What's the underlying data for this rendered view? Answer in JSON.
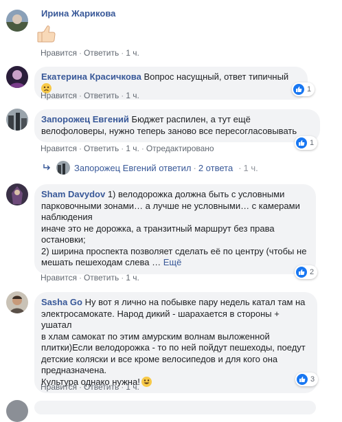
{
  "actions": {
    "like": "Нравится",
    "reply": "Ответить",
    "edited": "Отредактировано",
    "more": "Ещё"
  },
  "comments": [
    {
      "author": "Ирина Жарикова",
      "text": "",
      "sticker": "thumbs-up",
      "time": "1 ч."
    },
    {
      "author": "Екатерина Красичкова",
      "text": "Вопрос насущный, ответ типичный",
      "emoji": "sad-face",
      "time": "1 ч.",
      "reactions": "1"
    },
    {
      "author": "Запорожец Евгений",
      "text_lines": [
        "Бюджет распилен, а тут ещё",
        "велофоловеры, нужно теперь заново все пересогласовывать"
      ],
      "time": "1 ч.",
      "reactions": "1",
      "reply_summary": {
        "text": "Запорожец Евгений ответил",
        "count": "2 ответа",
        "time": "1 ч."
      }
    },
    {
      "author": "Sham Davydov",
      "text_lines": [
        "1) велодорожка должна быть с условными",
        "парковочными зонами… а лучше не условными… с камерами",
        "наблюдения",
        "иначе это не дорожка, а транзитный маршрут без права",
        "остановки;",
        "2) ширина проспекта позволяет сделать её по центру (чтобы не",
        "мешать пешеходам слева …"
      ],
      "time": "1 ч.",
      "reactions": "2"
    },
    {
      "author": "Sasha Go",
      "text_lines": [
        "Ну вот я лично на побывке пару недель катал там на",
        "электросамокате. Народ дикий - шарахается в стороны + ушатал",
        "в хлам самокат по этим амурским волнам выложенной",
        "плитки)Если велодорожка - то по ней пойдут пешеходы, поедут",
        "детские коляски и все кроме велосипедов и для кого она",
        "предназначена.",
        "Культура однако нужна!"
      ],
      "emoji": "smile",
      "time": "1 ч.",
      "reactions": "3"
    }
  ],
  "colors": {
    "link": "#385898",
    "bubble": "#f2f3f5",
    "like_blue": "#1877f2",
    "meta": "#606770"
  }
}
